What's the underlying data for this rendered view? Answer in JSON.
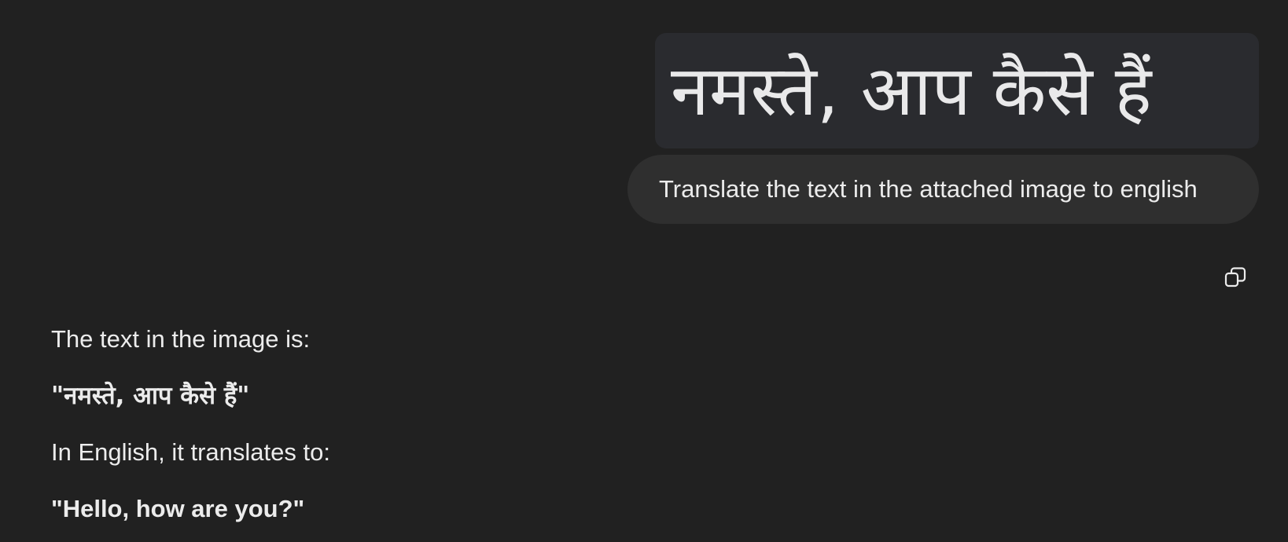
{
  "attachment": {
    "image_text": "नमस्ते, आप कैसे हैं"
  },
  "user_message": {
    "text": "Translate the text in the attached image to english"
  },
  "actions": {
    "copy_icon": "copy-icon"
  },
  "response": {
    "intro": "The text in the image is:",
    "original_quote": "\"नमस्ते, आप कैसे हैं\"",
    "translation_intro": "In English, it translates to:",
    "translation_quote": "\"Hello, how are you?\""
  }
}
